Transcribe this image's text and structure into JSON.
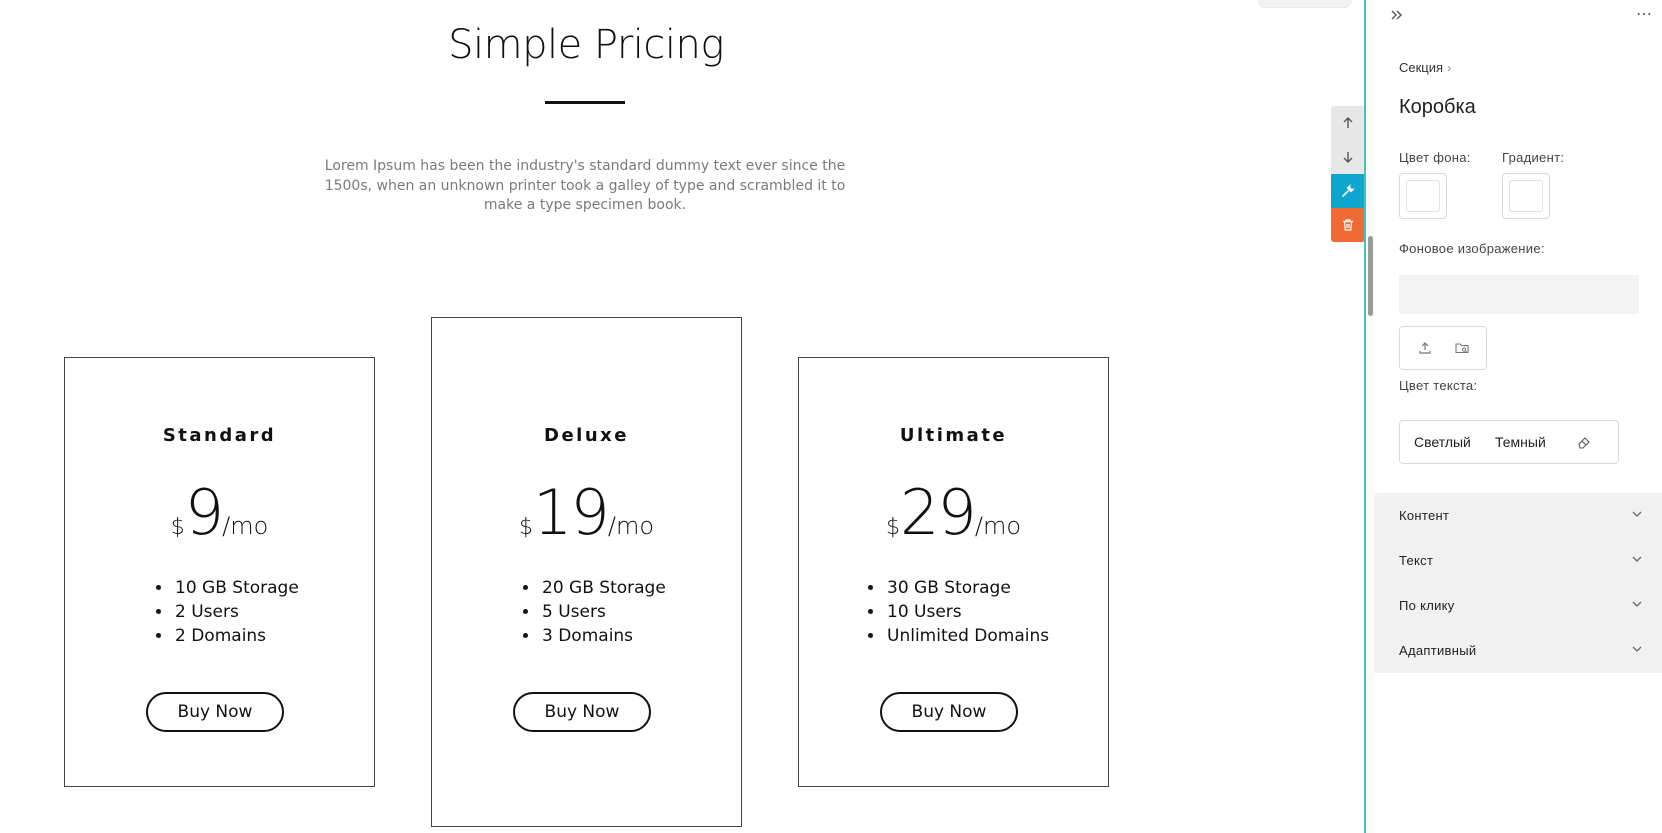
{
  "page": {
    "title": "Simple Pricing",
    "intro": "Lorem Ipsum has been the industry's standard dummy text ever since the 1500s, when an unknown printer took a galley of type and scrambled it to make a type specimen book."
  },
  "plans": [
    {
      "name": "Standard",
      "currency": "$",
      "amount": "9",
      "period": "/mo",
      "features": [
        "10 GB Storage",
        "2 Users",
        "2 Domains"
      ],
      "button": "Buy Now"
    },
    {
      "name": "Deluxe",
      "currency": "$",
      "amount": "19",
      "period": "/mo",
      "features": [
        "20 GB Storage",
        "5 Users",
        "3 Domains"
      ],
      "button": "Buy Now"
    },
    {
      "name": "Ultimate",
      "currency": "$",
      "amount": "29",
      "period": "/mo",
      "features": [
        "30 GB Storage",
        "10 Users",
        "Unlimited Domains"
      ],
      "button": "Buy Now"
    }
  ],
  "toolbar": {
    "icons": [
      "arrow-up-icon",
      "arrow-down-icon",
      "wrench-icon",
      "trash-icon"
    ],
    "colors": {
      "wrench": "#0ea5cf",
      "trash": "#f26a33",
      "divider": "#3ec5c0"
    }
  },
  "panel": {
    "breadcrumb": "Секция",
    "title": "Коробка",
    "bg_color_label": "Цвет фона:",
    "gradient_label": "Градиент:",
    "bg_image_label": "Фоновое изображение:",
    "text_color_label": "Цвет текста:",
    "text_color_light": "Светлый",
    "text_color_dark": "Темный",
    "accordion": [
      "Контент",
      "Текст",
      "По клику",
      "Адаптивный"
    ]
  }
}
